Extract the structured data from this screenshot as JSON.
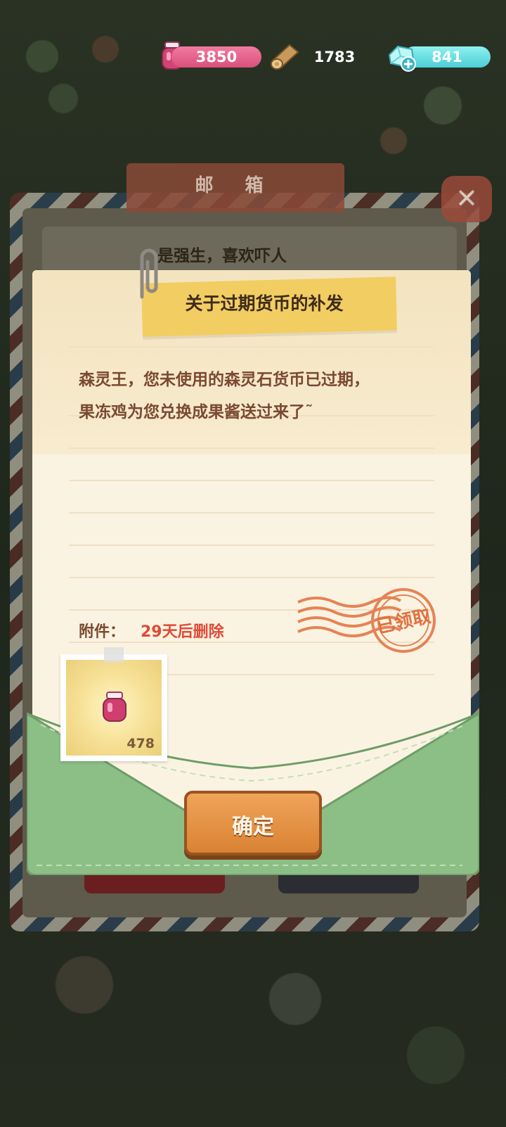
{
  "hud": {
    "jam_count": "3850",
    "wood_count": "1783",
    "gem_count": "841"
  },
  "mailbox": {
    "title": "邮 箱",
    "close_icon": "close-icon",
    "background_message_preview": "是强生，喜欢吓人"
  },
  "letter": {
    "title": "关于过期货币的补发",
    "body_lines": [
      "森灵王，您未使用的森灵石货币已过期，",
      "果冻鸡为您兑换成果酱送过来了˜"
    ],
    "attachment_label": "附件：",
    "attachment_expiry": "29天后删除",
    "stamp_text": "已领取",
    "attachment_item": {
      "icon": "jam-jar-icon",
      "quantity": "478"
    },
    "confirm_button": "确定"
  },
  "colors": {
    "jam_bar": "#e06090",
    "gem_bar": "#6fe0e4",
    "title_tape": "#f2cd62",
    "confirm_button": "#e8943f",
    "expiry_text": "#e04a36",
    "stamp": "#e2703f",
    "envelope": "#8cbf86"
  }
}
